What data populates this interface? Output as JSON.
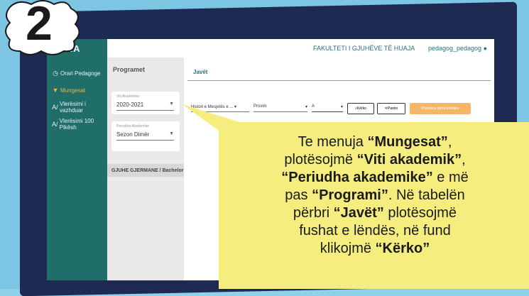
{
  "step_badge": {
    "number": "2"
  },
  "sidebar": {
    "logo": "SORA",
    "items": [
      {
        "label": "Orari Pedagoge",
        "icon": "clock-icon",
        "active": false
      },
      {
        "label": "Mungesat",
        "icon": "shield-icon",
        "active": true
      },
      {
        "label": "Vlerësimi i vazhduar",
        "icon": "grade-icon",
        "active": false
      },
      {
        "label": "Vlerësimi 100 Pikësh",
        "icon": "grade-icon",
        "active": false
      }
    ]
  },
  "topbar": {
    "faculty": "FAKULTETI I GJUHËVE TË HUAJA",
    "user": "pedagog_pedagog"
  },
  "programet": {
    "title": "Programet",
    "viti_label": "Viti Akademike",
    "viti_value": "2020-2021",
    "periudha_label": "Periudha Akademike",
    "periudha_value": "Sezon Dimër",
    "program_item": "GJUHE GJERMANE / Bachelor"
  },
  "javet": {
    "title": "Javët",
    "filter_subject": "Histori e Mesjetës e ...",
    "filter_type": "Provim",
    "filter_group": "A",
    "search_button": "Kërko",
    "clear_button": "Pastro",
    "presence_button": "Prezenca përfundimtare"
  },
  "callout": {
    "line1_a": "Te menuja ",
    "line1_b": "“Mungesat”",
    "line1_c": ",",
    "line2_a": "plotësojmë ",
    "line2_b": "“Viti akademik”",
    "line2_c": ",",
    "line3_a": "“Periudha akademike”",
    "line3_b": " e më",
    "line4_a": "pas ",
    "line4_b": "“Programi”",
    "line4_c": ". Në tabelën",
    "line5_a": "përbri ",
    "line5_b": "“Javët”",
    "line5_c": " plotësojmë",
    "line6": "fushat e lëndës, në fund",
    "line7_a": "klikojmë ",
    "line7_b": "“Kërko”"
  },
  "colors": {
    "sidebar": "#1f6e6a",
    "accent": "#f3b23a",
    "callout": "#f5ee7e",
    "background": "#8fd0ea",
    "monitor": "#1f2a52"
  }
}
